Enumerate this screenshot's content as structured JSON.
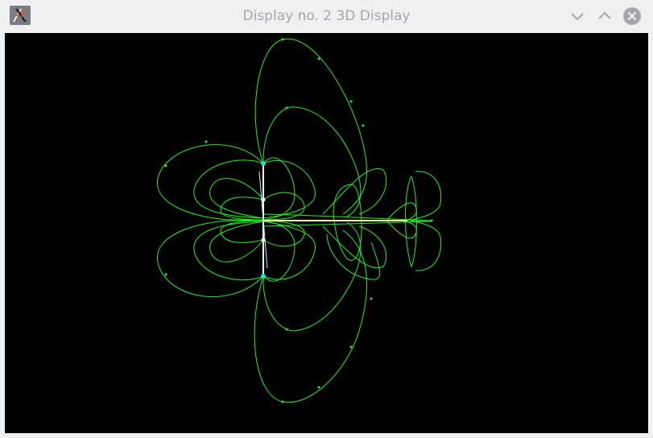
{
  "window": {
    "title": "Display no. 2 3D Display",
    "app_icon": "x11-icon",
    "controls": {
      "minimize_icon": "chevron-down-icon",
      "maximize_icon": "chevron-up-icon",
      "close_icon": "close-circle-icon"
    }
  },
  "display": {
    "background_color": "#000000",
    "line_color": "#22ee22",
    "highlight_color": "#ffff99",
    "marker_color": "#22dddd",
    "content": "field-lines-3d-render"
  }
}
